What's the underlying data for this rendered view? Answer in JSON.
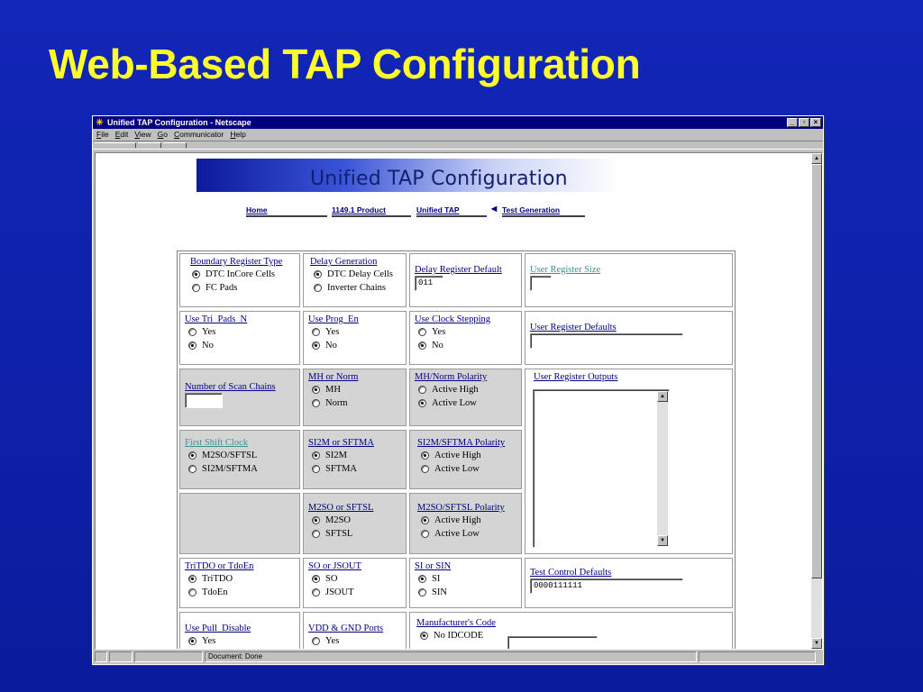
{
  "slide": {
    "title": "Web-Based TAP Configuration"
  },
  "browser": {
    "title": "Unified TAP Configuration - Netscape",
    "menu": [
      "File",
      "Edit",
      "View",
      "Go",
      "Communicator",
      "Help"
    ],
    "status": "Document: Done"
  },
  "page": {
    "banner": "Unified TAP Configuration",
    "nav": [
      "Home",
      "1149.1 Product",
      "Unified TAP",
      "Test Generation"
    ]
  },
  "cfg": {
    "boundary_register_type": {
      "label": "Boundary Register Type",
      "opt1": "DTC InCore Cells",
      "opt2": "FC Pads"
    },
    "delay_generation": {
      "label": "Delay Generation",
      "opt1": "DTC Delay Cells",
      "opt2": "Inverter Chains"
    },
    "delay_register_default": {
      "label": "Delay Register Default",
      "value": "011"
    },
    "user_register_size": {
      "label": "User Register Size",
      "value": ""
    },
    "use_tri_pads_n": {
      "label": "Use Tri_Pads_N",
      "opt1": "Yes",
      "opt2": "No"
    },
    "use_prog_en": {
      "label": "Use Prog_En",
      "opt1": "Yes",
      "opt2": "No"
    },
    "use_clock_stepping": {
      "label": "Use Clock Stepping",
      "opt1": "Yes",
      "opt2": "No"
    },
    "user_register_defaults": {
      "label": "User Register Defaults",
      "value": ""
    },
    "number_of_scan_chains": {
      "label": "Number of Scan Chains",
      "value": ""
    },
    "mh_or_norm": {
      "label": "MH or Norm",
      "opt1": "MH",
      "opt2": "Norm"
    },
    "mh_norm_polarity": {
      "label": "MH/Norm Polarity",
      "opt1": "Active High",
      "opt2": "Active Low"
    },
    "user_register_outputs": {
      "label": "User Register Outputs"
    },
    "first_shift_clock": {
      "label": "First Shift Clock",
      "opt1": "M2SO/SFTSL",
      "opt2": "SI2M/SFTMA"
    },
    "si2m_or_sftma": {
      "label": "SI2M or SFTMA",
      "opt1": "SI2M",
      "opt2": "SFTMA"
    },
    "si2m_sftma_polarity": {
      "label": "SI2M/SFTMA Polarity",
      "opt1": "Active High",
      "opt2": "Active Low"
    },
    "m2so_or_sftsl": {
      "label": "M2SO or SFTSL",
      "opt1": "M2SO",
      "opt2": "SFTSL"
    },
    "m2so_sftsl_polarity": {
      "label": "M2SO/SFTSL Polarity",
      "opt1": "Active High",
      "opt2": "Active Low"
    },
    "tritdo_or_tdoen": {
      "label": "TriTDO or TdoEn",
      "opt1": "TriTDO",
      "opt2": "TdoEn"
    },
    "so_or_jsout": {
      "label": "SO or JSOUT",
      "opt1": "SO",
      "opt2": "JSOUT"
    },
    "si_or_sin": {
      "label": "SI or SIN",
      "opt1": "SI",
      "opt2": "SIN"
    },
    "test_control_defaults": {
      "label": "Test Control Defaults",
      "value": "0000111111"
    },
    "use_pull_disable": {
      "label": "Use Pull_Disable",
      "opt1": "Yes"
    },
    "vdd_gnd_ports": {
      "label": "VDD & GND Ports",
      "opt1": "Yes"
    },
    "manufacturers_code": {
      "label": "Manufacturer's Code",
      "opt1": "No IDCODE",
      "value": ""
    }
  }
}
